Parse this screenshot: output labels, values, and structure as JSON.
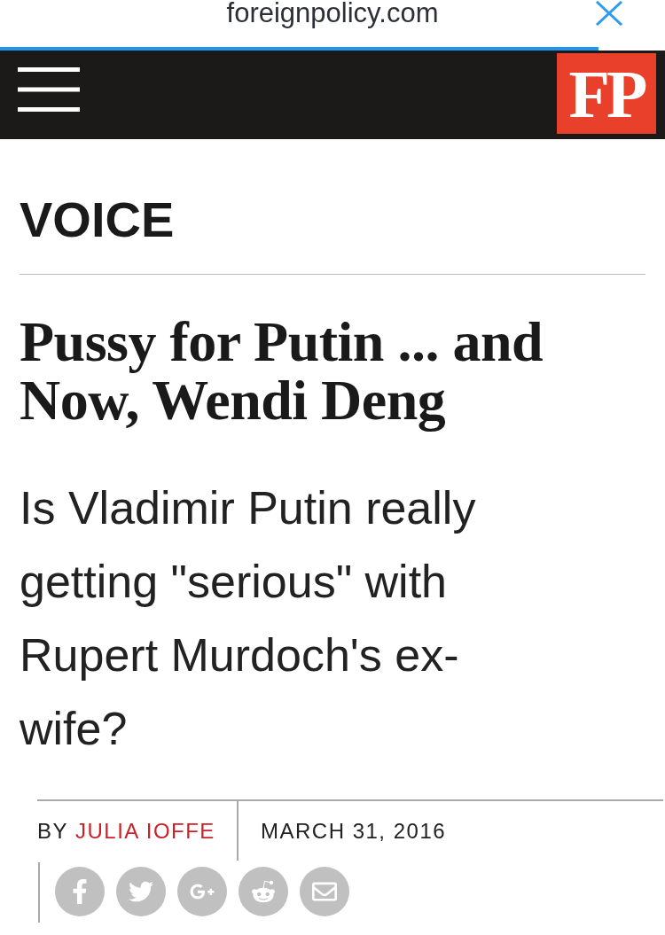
{
  "browser_bar": {
    "url": "foreignpolicy.com",
    "loading_bar": {
      "level": 0.9
    }
  },
  "header": {
    "logo": "FP"
  },
  "article": {
    "section": "VOICE",
    "headline": "Pussy for Putin ... and Now, Wendi Deng",
    "dek": "Is Vladimir Putin really getting \"serious\" with Rupert Murdoch's ex-wife?"
  },
  "byline": {
    "prefix": "BY",
    "author": "JULIA IOFFE",
    "date": "MARCH 31, 2016"
  },
  "share_buttons": [
    {
      "kind": "facebook"
    },
    {
      "kind": "twitter"
    },
    {
      "kind": "googleplus"
    },
    {
      "kind": "reddit"
    },
    {
      "kind": "email"
    }
  ]
}
